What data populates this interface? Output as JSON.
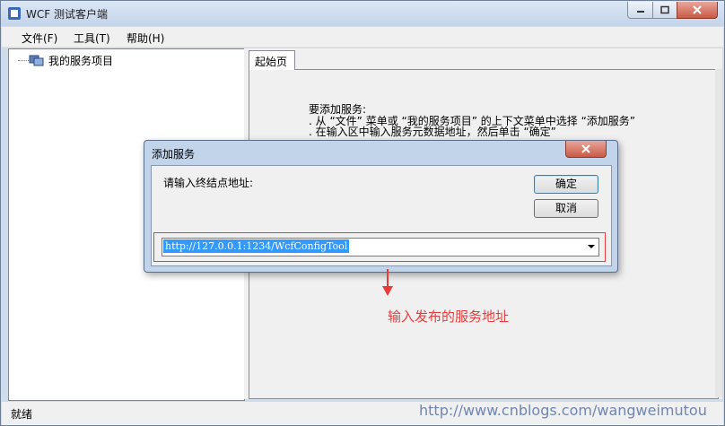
{
  "window": {
    "title": "WCF 测试客户端"
  },
  "menu": [
    "文件(F)",
    "工具(T)",
    "帮助(H)"
  ],
  "tree": {
    "root_label": "我的服务项目"
  },
  "tabs": [
    "起始页"
  ],
  "start_page": {
    "heading": "要添加服务:",
    "line1": ".  从 “文件” 菜单或 “我的服务项目” 的上下文菜单中选择 “添加服务”",
    "line2": ".  在输入区中输入服务元数据地址，然后单击 “确定”"
  },
  "dialog": {
    "title": "添加服务",
    "prompt": "请输入终结点地址:",
    "ok_label": "确定",
    "cancel_label": "取消",
    "address_value": "http://127.0.0.1:1234/WcfConfigTool"
  },
  "annotation": "输入发布的服务地址",
  "status": {
    "text": "就绪"
  },
  "watermark": "http://www.cnblogs.com/wangweimutou"
}
